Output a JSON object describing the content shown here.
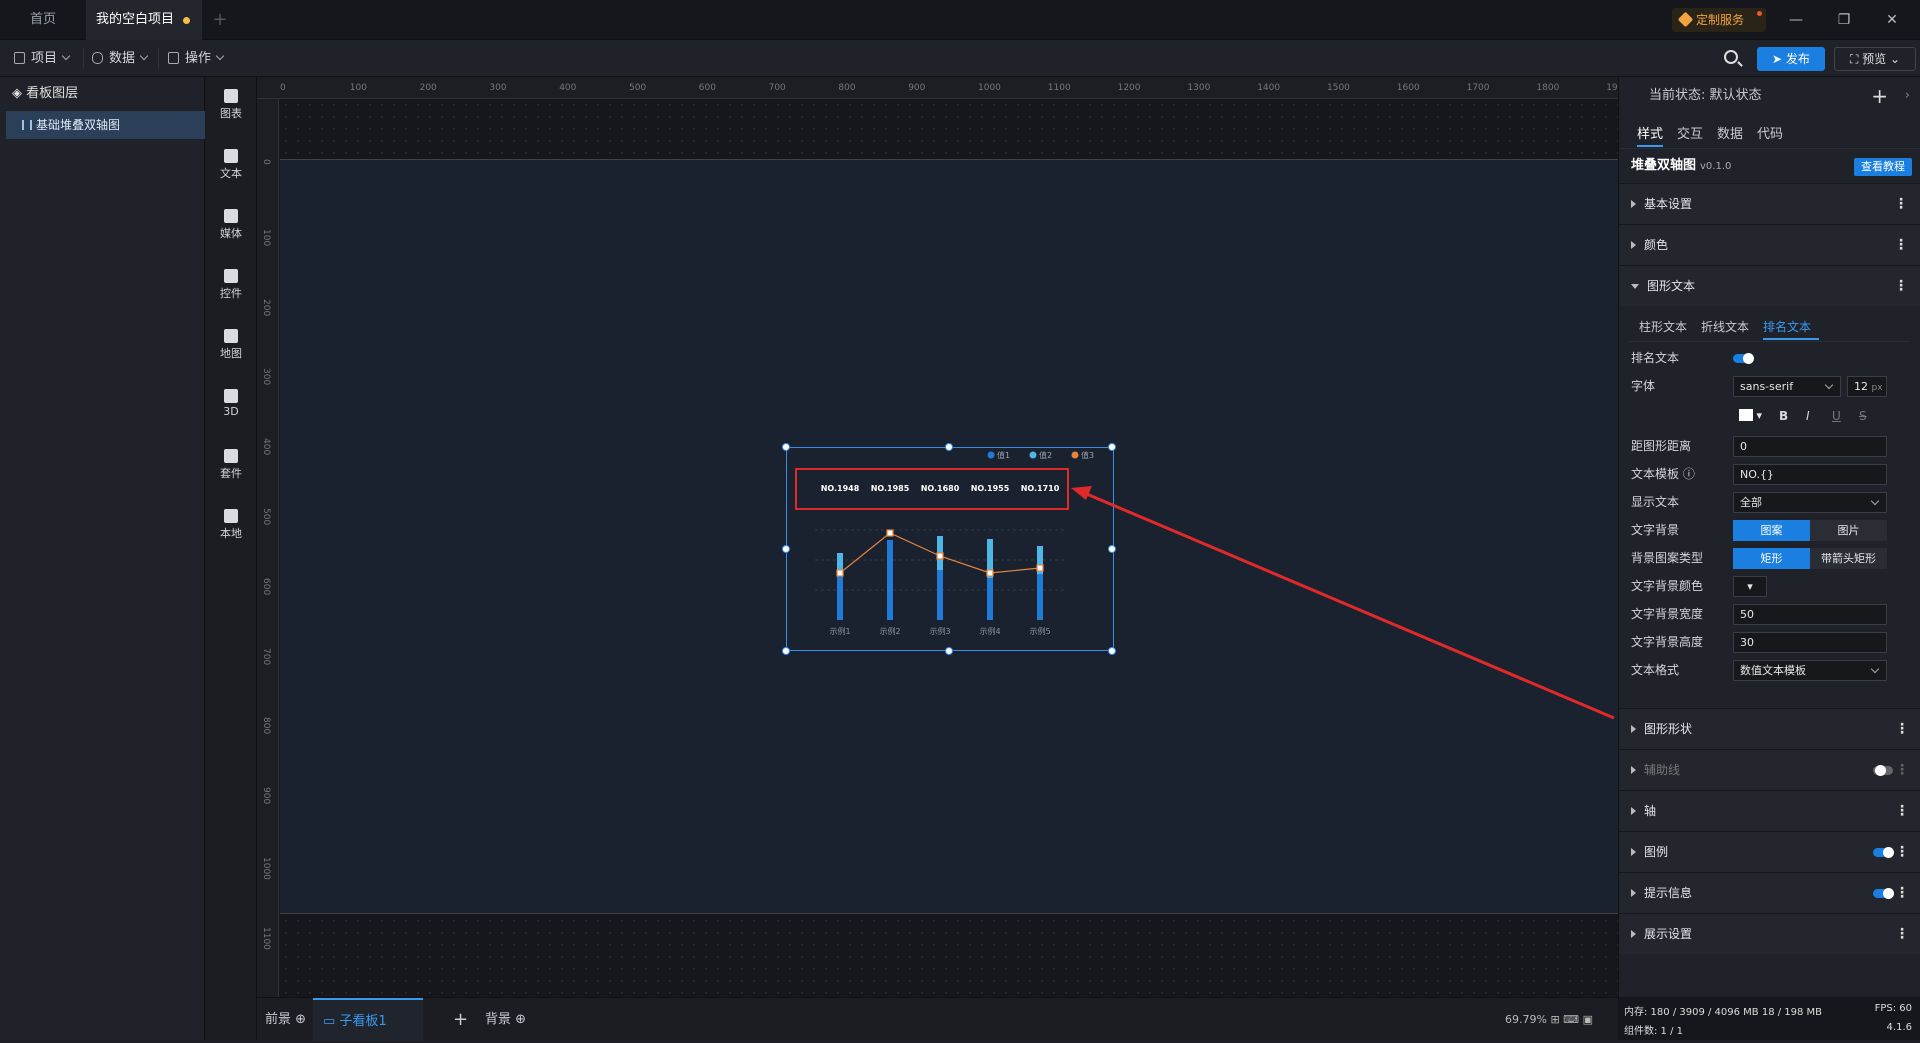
{
  "tabs": {
    "home": "首页",
    "project": "我的空白项目",
    "add": "+"
  },
  "custom_service": "定制服务",
  "window": {
    "minimize": "—",
    "restore": "❐",
    "close": "✕"
  },
  "toolbar": {
    "project": "项目",
    "data": "数据",
    "operate": "操作",
    "publish": "发布",
    "preview": "预览"
  },
  "layers": {
    "title": "看板图层",
    "item": "基础堆叠双轴图"
  },
  "components": [
    "图表",
    "文本",
    "媒体",
    "控件",
    "地图",
    "3D",
    "套件",
    "本地"
  ],
  "ruler_top": [
    "0",
    "100",
    "200",
    "300",
    "400",
    "500",
    "600",
    "700",
    "800",
    "900",
    "1000",
    "1100",
    "1200",
    "1300",
    "1400",
    "1500",
    "1600",
    "1700",
    "1800",
    "1900"
  ],
  "ruler_left": [
    "0",
    "100",
    "200",
    "300",
    "400",
    "500",
    "600",
    "700",
    "800",
    "900",
    "1000",
    "1100"
  ],
  "chart_data": {
    "type": "bar",
    "categories": [
      "示例1",
      "示例2",
      "示例3",
      "示例4",
      "示例5"
    ],
    "legend": [
      "值1",
      "值2",
      "值3"
    ],
    "rank_labels": [
      "NO.1948",
      "NO.1985",
      "NO.1680",
      "NO.1955",
      "NO.1710"
    ],
    "series": [
      {
        "name": "值1",
        "values": [
          46,
          80,
          50,
          42,
          46
        ]
      },
      {
        "name": "值2",
        "values": [
          21,
          0,
          34,
          39,
          28
        ]
      },
      {
        "name": "值3",
        "values": [
          47,
          87,
          64,
          47,
          52
        ]
      }
    ],
    "colors": {
      "bar_bottom": "#1f7ad8",
      "bar_top": "#4fb6e8",
      "line": "#e8833a",
      "legend3": "#e8833a"
    }
  },
  "bottom": {
    "foreground": "前景",
    "sub_board": "子看板1",
    "add": "+",
    "background": "背景",
    "zoom": "69.79%"
  },
  "panel": {
    "state_label": "当前状态: 默认状态",
    "tabs": [
      "样式",
      "交互",
      "数据",
      "代码"
    ],
    "component_title": "堆叠双轴图",
    "version": "v0.1.0",
    "tutorial": "查看教程",
    "sections_top": [
      "基本设置",
      "颜色",
      "图形文本"
    ],
    "subtabs": [
      "柱形文本",
      "折线文本",
      "排名文本"
    ],
    "props": {
      "rank_text": "排名文本",
      "font": "字体",
      "font_family": "sans-serif",
      "font_size": "12",
      "font_unit": "px",
      "bold": "B",
      "italic": "I",
      "underline": "U",
      "strike": "S",
      "distance": "距图形距离",
      "distance_val": "0",
      "template": "文本模板",
      "template_val": "NO.{}",
      "show_text": "显示文本",
      "show_text_val": "全部",
      "text_bg": "文字背景",
      "bg_pattern": "图案",
      "bg_image": "图片",
      "bg_pattern_type": "背景图案类型",
      "rect": "矩形",
      "arrow_rect": "带箭头矩形",
      "bg_color": "文字背景颜色",
      "bg_width": "文字背景宽度",
      "bg_width_val": "50",
      "bg_height": "文字背景高度",
      "bg_height_val": "30",
      "text_format": "文本格式",
      "text_format_val": "数值文本模板"
    },
    "sections_bottom": [
      "图形形状",
      "辅助线",
      "轴",
      "图例",
      "提示信息",
      "展示设置"
    ]
  },
  "status": {
    "memory": "内存:  180 / 3909 / 4096 MB  18 / 198 MB",
    "fps": "FPS:  60",
    "components": "组件数: 1 / 1",
    "version": "4.1.6"
  }
}
